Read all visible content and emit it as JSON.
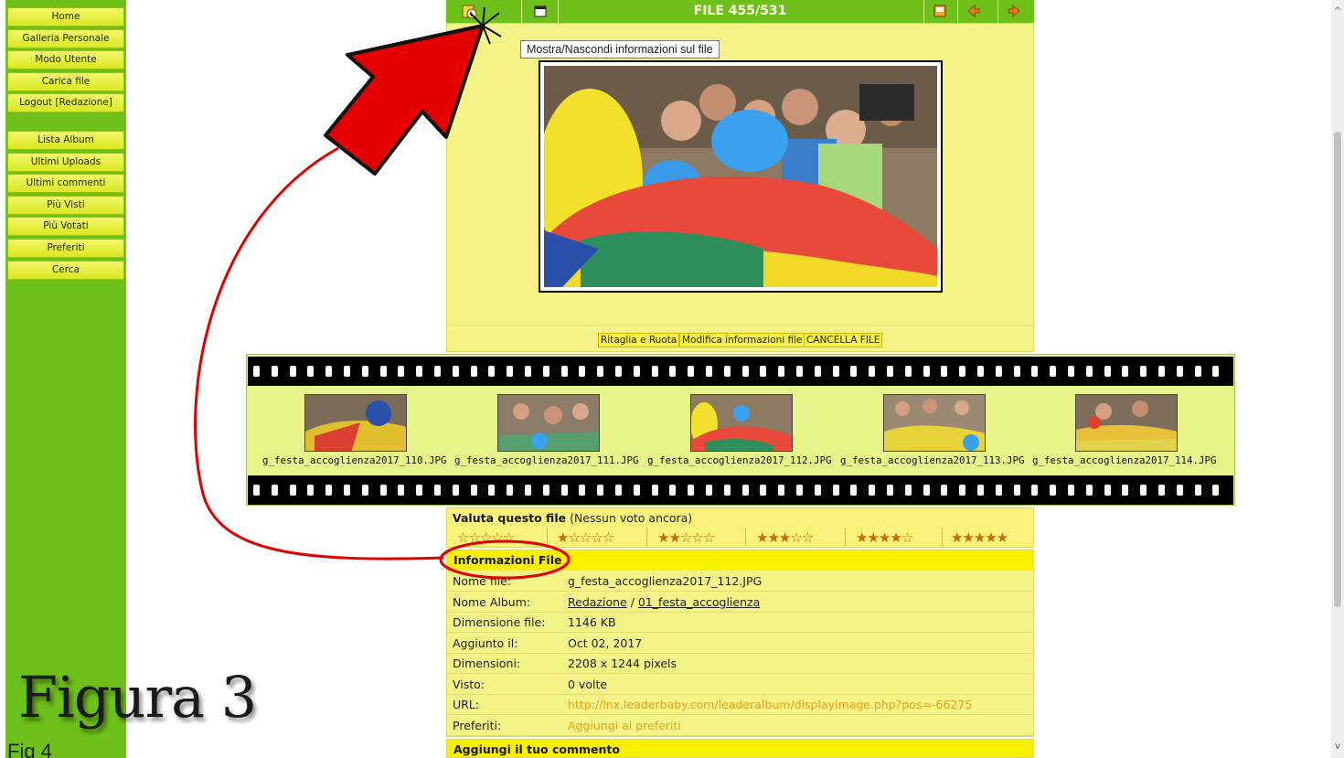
{
  "sidebar": {
    "group1": [
      "Home",
      "Galleria Personale",
      "Modo Utente",
      "Carica file",
      "Logout [Redazione]"
    ],
    "group2": [
      "Lista Album",
      "Ultimi Uploads",
      "Ultimi commenti",
      "Più Visti",
      "Più Votati",
      "Preferiti",
      "Cerca"
    ]
  },
  "topbar": {
    "title": "FILE 455/531",
    "icons": [
      "info-icon",
      "slideshow-icon",
      "print-icon",
      "prev-icon",
      "next-icon"
    ]
  },
  "tooltip": "Mostra/Nascondi informazioni sul file",
  "actions": [
    "Ritaglia e Ruota",
    "Modifica informazioni file",
    "CANCELLA FILE"
  ],
  "filmstrip": {
    "thumbnails": [
      "g_festa_accoglienza2017_110.JPG",
      "g_festa_accoglienza2017_111.JPG",
      "g_festa_accoglienza2017_112.JPG",
      "g_festa_accoglienza2017_113.JPG",
      "g_festa_accoglienza2017_114.JPG"
    ]
  },
  "rating": {
    "label": "Valuta questo file",
    "status": "(Nessun voto ancora)",
    "options": [
      "☆☆☆☆☆",
      "★☆☆☆☆",
      "★★☆☆☆",
      "★★★☆☆",
      "★★★★☆",
      "★★★★★"
    ]
  },
  "info": {
    "title": "Informazioni File",
    "rows": [
      {
        "label": "Nome file:",
        "value": "g_festa_accoglienza2017_112.JPG"
      },
      {
        "label": "Nome Album:",
        "album_parent": "Redazione",
        "separator": " / ",
        "album": "01_festa_accoglienza"
      },
      {
        "label": "Dimensione file:",
        "value": "1146 KB"
      },
      {
        "label": "Aggiunto il:",
        "value": "Oct 02, 2017"
      },
      {
        "label": "Dimensioni:",
        "value": "2208 x 1244 pixels"
      },
      {
        "label": "Visto:",
        "value": "0 volte"
      },
      {
        "label": "URL:",
        "value": "http://lnx.leaderbaby.com/leaderalbum/displayimage.php?pos=-66275"
      },
      {
        "label": "Preferiti:",
        "value": "Aggiungi ai preferiti"
      }
    ],
    "comment_title": "Aggiungi il tuo commento"
  },
  "annotation": {
    "caption": "Figura 3",
    "caption2": "Fig 4",
    "arrow_color": "#e00000"
  },
  "colors": {
    "sidebar": "#6ec01b",
    "panel": "#f4f388",
    "header_yellow": "#f8f000",
    "link_orange": "#e8a21a"
  }
}
